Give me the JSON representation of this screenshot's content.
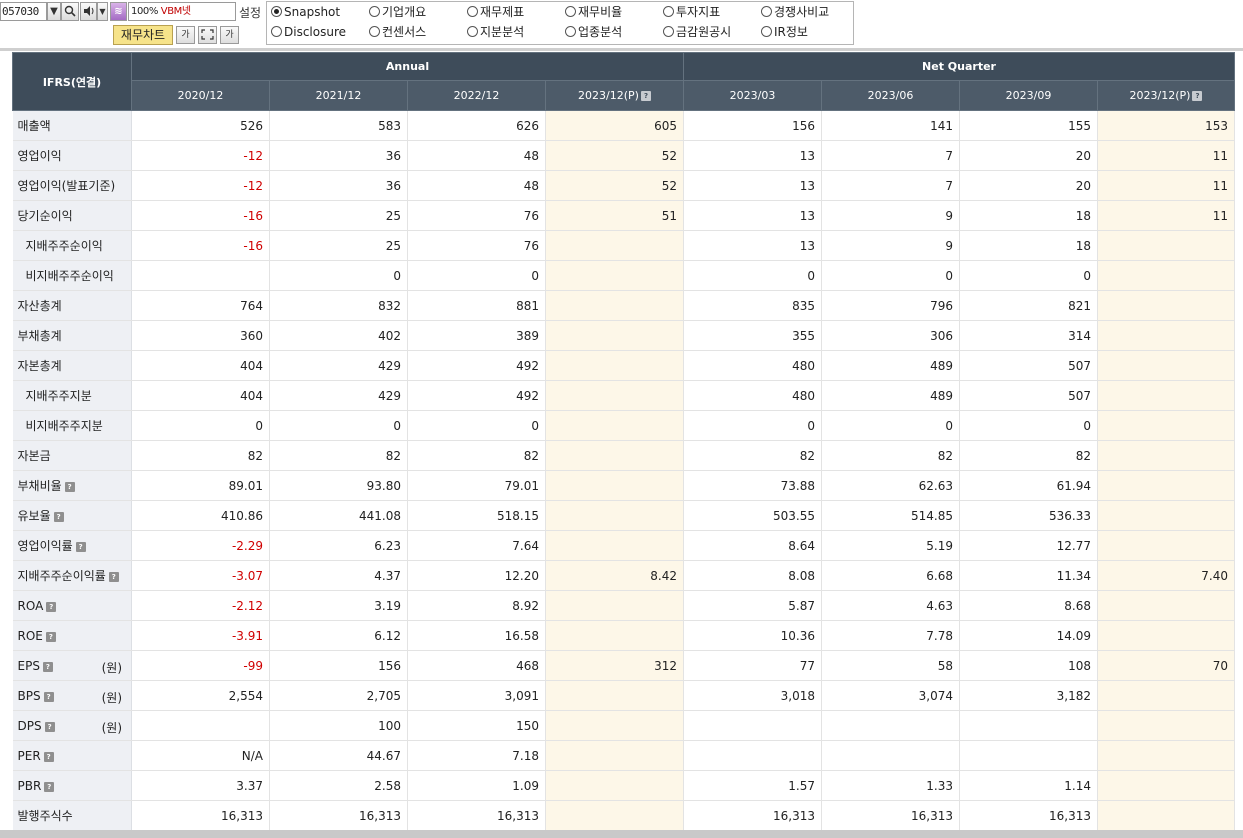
{
  "toolbar": {
    "code": "057030",
    "zoom": "100%",
    "zoom_value": "VBM넷",
    "setting_label": "설정",
    "chart_button": "재무차트",
    "font_button_1": "가",
    "font_button_2": "가",
    "radio_options": [
      {
        "label": "Snapshot",
        "selected": true
      },
      {
        "label": "기업개요",
        "selected": false
      },
      {
        "label": "재무제표",
        "selected": false
      },
      {
        "label": "재무비율",
        "selected": false
      },
      {
        "label": "투자지표",
        "selected": false
      },
      {
        "label": "경쟁사비교",
        "selected": false
      },
      {
        "label": "Disclosure",
        "selected": false
      },
      {
        "label": "컨센서스",
        "selected": false
      },
      {
        "label": "지분분석",
        "selected": false
      },
      {
        "label": "업종분석",
        "selected": false
      },
      {
        "label": "금감원공시",
        "selected": false
      },
      {
        "label": "IR정보",
        "selected": false
      }
    ]
  },
  "table": {
    "corner": "IFRS(연결)",
    "group_annual": "Annual",
    "group_quarter": "Net Quarter",
    "periods": [
      "2020/12",
      "2021/12",
      "2022/12",
      "2023/12(P)",
      "2023/03",
      "2023/06",
      "2023/09",
      "2023/12(P)"
    ],
    "rows": [
      {
        "label": "매출액",
        "indent": false,
        "help": false,
        "unit": "",
        "values": [
          "526",
          "583",
          "626",
          "605",
          "156",
          "141",
          "155",
          "153"
        ]
      },
      {
        "label": "영업이익",
        "indent": false,
        "help": false,
        "unit": "",
        "values": [
          "-12",
          "36",
          "48",
          "52",
          "13",
          "7",
          "20",
          "11"
        ]
      },
      {
        "label": "영업이익(발표기준)",
        "indent": false,
        "help": false,
        "unit": "",
        "values": [
          "-12",
          "36",
          "48",
          "52",
          "13",
          "7",
          "20",
          "11"
        ]
      },
      {
        "label": "당기순이익",
        "indent": false,
        "help": false,
        "unit": "",
        "values": [
          "-16",
          "25",
          "76",
          "51",
          "13",
          "9",
          "18",
          "11"
        ]
      },
      {
        "label": "지배주주순이익",
        "indent": true,
        "help": false,
        "unit": "",
        "values": [
          "-16",
          "25",
          "76",
          "",
          "13",
          "9",
          "18",
          ""
        ]
      },
      {
        "label": "비지배주주순이익",
        "indent": true,
        "help": false,
        "unit": "",
        "values": [
          "",
          "0",
          "0",
          "",
          "0",
          "0",
          "0",
          ""
        ]
      },
      {
        "label": "자산총계",
        "indent": false,
        "help": false,
        "unit": "",
        "values": [
          "764",
          "832",
          "881",
          "",
          "835",
          "796",
          "821",
          ""
        ]
      },
      {
        "label": "부채총계",
        "indent": false,
        "help": false,
        "unit": "",
        "values": [
          "360",
          "402",
          "389",
          "",
          "355",
          "306",
          "314",
          ""
        ]
      },
      {
        "label": "자본총계",
        "indent": false,
        "help": false,
        "unit": "",
        "values": [
          "404",
          "429",
          "492",
          "",
          "480",
          "489",
          "507",
          ""
        ]
      },
      {
        "label": "지배주주지분",
        "indent": true,
        "help": false,
        "unit": "",
        "values": [
          "404",
          "429",
          "492",
          "",
          "480",
          "489",
          "507",
          ""
        ]
      },
      {
        "label": "비지배주주지분",
        "indent": true,
        "help": false,
        "unit": "",
        "values": [
          "0",
          "0",
          "0",
          "",
          "0",
          "0",
          "0",
          ""
        ]
      },
      {
        "label": "자본금",
        "indent": false,
        "help": false,
        "unit": "",
        "values": [
          "82",
          "82",
          "82",
          "",
          "82",
          "82",
          "82",
          ""
        ]
      },
      {
        "label": "부채비율",
        "indent": false,
        "help": true,
        "unit": "",
        "values": [
          "89.01",
          "93.80",
          "79.01",
          "",
          "73.88",
          "62.63",
          "61.94",
          ""
        ]
      },
      {
        "label": "유보율",
        "indent": false,
        "help": true,
        "unit": "",
        "values": [
          "410.86",
          "441.08",
          "518.15",
          "",
          "503.55",
          "514.85",
          "536.33",
          ""
        ]
      },
      {
        "label": "영업이익률",
        "indent": false,
        "help": true,
        "unit": "",
        "values": [
          "-2.29",
          "6.23",
          "7.64",
          "",
          "8.64",
          "5.19",
          "12.77",
          ""
        ]
      },
      {
        "label": "지배주주순이익률",
        "indent": false,
        "help": true,
        "unit": "",
        "values": [
          "-3.07",
          "4.37",
          "12.20",
          "8.42",
          "8.08",
          "6.68",
          "11.34",
          "7.40"
        ]
      },
      {
        "label": "ROA",
        "indent": false,
        "help": true,
        "unit": "",
        "values": [
          "-2.12",
          "3.19",
          "8.92",
          "",
          "5.87",
          "4.63",
          "8.68",
          ""
        ]
      },
      {
        "label": "ROE",
        "indent": false,
        "help": true,
        "unit": "",
        "values": [
          "-3.91",
          "6.12",
          "16.58",
          "",
          "10.36",
          "7.78",
          "14.09",
          ""
        ]
      },
      {
        "label": "EPS",
        "indent": false,
        "help": true,
        "unit": "(원)",
        "values": [
          "-99",
          "156",
          "468",
          "312",
          "77",
          "58",
          "108",
          "70"
        ]
      },
      {
        "label": "BPS",
        "indent": false,
        "help": true,
        "unit": "(원)",
        "values": [
          "2,554",
          "2,705",
          "3,091",
          "",
          "3,018",
          "3,074",
          "3,182",
          ""
        ]
      },
      {
        "label": "DPS",
        "indent": false,
        "help": true,
        "unit": "(원)",
        "values": [
          "",
          "100",
          "150",
          "",
          "",
          "",
          "",
          ""
        ]
      },
      {
        "label": "PER",
        "indent": false,
        "help": true,
        "unit": "",
        "values": [
          "N/A",
          "44.67",
          "7.18",
          "",
          "",
          "",
          "",
          ""
        ]
      },
      {
        "label": "PBR",
        "indent": false,
        "help": true,
        "unit": "",
        "values": [
          "3.37",
          "2.58",
          "1.09",
          "",
          "1.57",
          "1.33",
          "1.14",
          ""
        ]
      },
      {
        "label": "발행주식수",
        "indent": false,
        "help": false,
        "unit": "",
        "values": [
          "16,313",
          "16,313",
          "16,313",
          "",
          "16,313",
          "16,313",
          "16,313",
          ""
        ]
      }
    ]
  },
  "colors": {
    "header_bg": "#3e4c5a",
    "subheader_bg": "#4d5b69",
    "label_bg": "#eef0f4",
    "estimate_bg": "#fdf7e8",
    "negative": "#d00000",
    "chart_button_bg": "#f6e38a"
  }
}
